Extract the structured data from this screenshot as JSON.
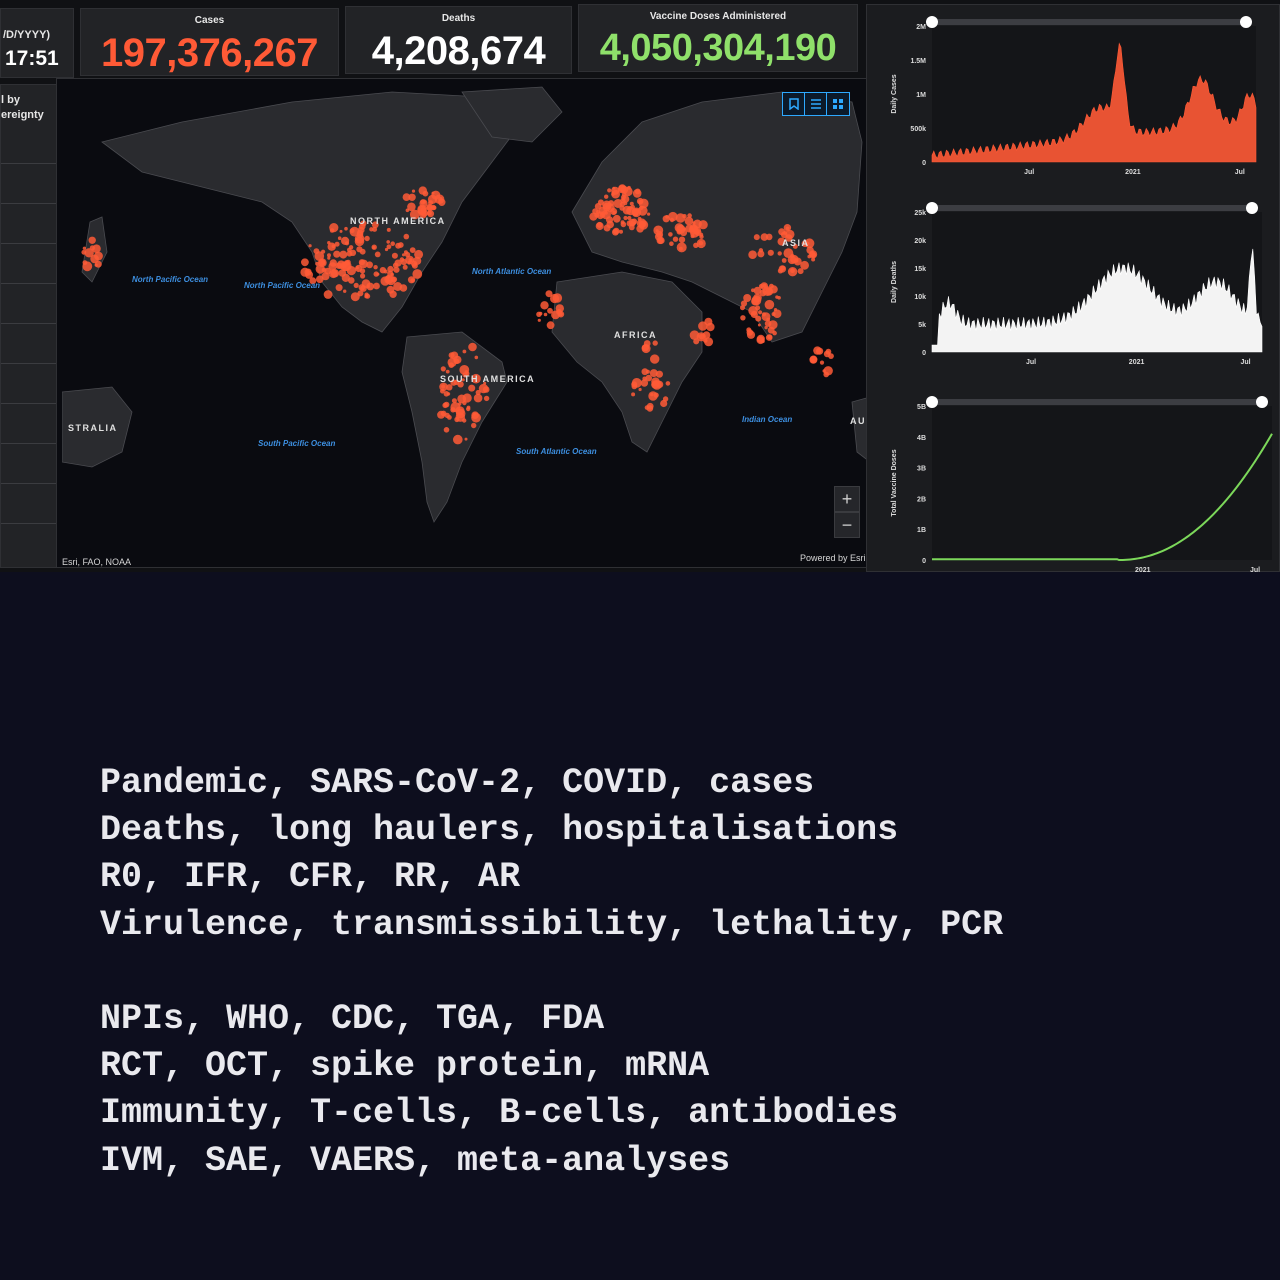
{
  "header": {
    "date_label": "/D/YYYY)",
    "time": "17:51",
    "sidebar_title_line1": "l by",
    "sidebar_title_line2": "ereignty"
  },
  "tiles": {
    "cases": {
      "label": "Cases",
      "value": "197,376,267",
      "color": "#ff5a36"
    },
    "deaths": {
      "label": "Deaths",
      "value": "4,208,674",
      "color": "#ffffff"
    },
    "vaccine": {
      "label": "Vaccine Doses Administered",
      "value": "4,050,304,190",
      "color": "#8fe06a"
    }
  },
  "map": {
    "labels": {
      "north_america": "NORTH AMERICA",
      "south_america": "SOUTH AMERICA",
      "africa": "AFRICA",
      "asia": "ASIA",
      "australia": "STRALIA",
      "au": "AU",
      "north_pacific_1": "North Pacific Ocean",
      "north_pacific_2": "North Pacific Ocean",
      "north_atlantic": "North Atlantic Ocean",
      "south_pacific": "South Pacific Ocean",
      "south_atlantic": "South Atlantic Ocean",
      "indian": "Indian Ocean"
    },
    "zoom_in": "+",
    "zoom_out": "−",
    "attribution": "Esri, FAO, NOAA",
    "powered_by": "Powered by Esri",
    "tools": [
      "bookmark-icon",
      "list-icon",
      "basemap-icon"
    ],
    "dot_color": "#ff5a36"
  },
  "charts": {
    "daily_cases": {
      "ylabel": "Daily Cases",
      "yticks": [
        "2M",
        "1.5M",
        "1M",
        "500k",
        "0"
      ],
      "xticks": [
        "Jul",
        "2021",
        "Jul"
      ],
      "color": "#ff5a36"
    },
    "daily_deaths": {
      "ylabel": "Daily Deaths",
      "yticks": [
        "25k",
        "20k",
        "15k",
        "10k",
        "5k",
        "0"
      ],
      "xticks": [
        "Jul",
        "2021",
        "Jul"
      ],
      "color": "#ffffff"
    },
    "vaccine_doses": {
      "ylabel": "Total Vaccine Doses",
      "yticks": [
        "5B",
        "4B",
        "3B",
        "2B",
        "1B",
        "0"
      ],
      "xticks": [
        "2021",
        "Jul"
      ],
      "color": "#7cd85a"
    }
  },
  "terms": [
    "Pandemic, SARS-CoV-2, COVID, cases",
    "Deaths, long haulers, hospitalisations",
    "R0, IFR, CFR, RR, AR",
    "Virulence, transmissibility, lethality, PCR",
    "",
    "NPIs, WHO, CDC, TGA, FDA",
    "RCT, OCT, spike protein, mRNA",
    "Immunity, T-cells, B-cells, antibodies",
    "IVM, SAE, VAERS, meta-analyses"
  ]
}
